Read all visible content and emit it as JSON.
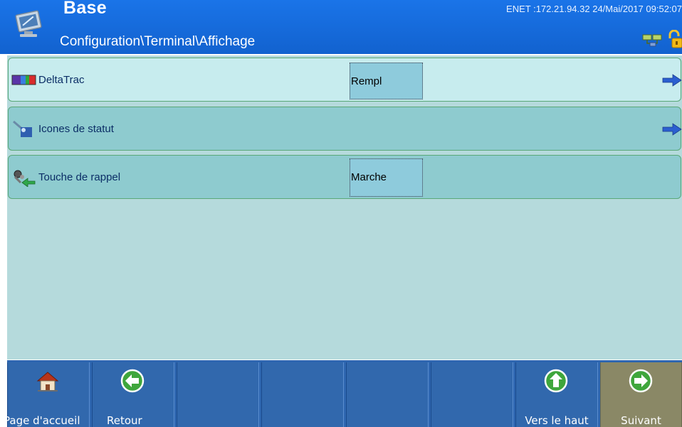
{
  "header": {
    "title": "Base",
    "path": "Configuration\\Terminal\\Affichage",
    "status": "ENET :172.21.94.32 24/Mai/2017 09:52:07",
    "app_icon": "monitor-icon",
    "net_icon": "network-icon",
    "lock_icon": "lock-icon"
  },
  "rows": [
    {
      "label": "DeltaTrac",
      "value": "Rempl",
      "icon": "deltatrac-icon",
      "has_arrow": true
    },
    {
      "label": "Icones de statut",
      "value": "",
      "icon": "status-icons-icon",
      "has_arrow": true
    },
    {
      "label": "Touche de rappel",
      "value": "Marche",
      "icon": "recall-key-icon",
      "has_arrow": false
    }
  ],
  "softkeys": [
    {
      "label": "Page d'accueil",
      "icon": "home-icon"
    },
    {
      "label": "Retour",
      "icon": "back-arrow-icon"
    },
    {
      "label": "",
      "icon": ""
    },
    {
      "label": "",
      "icon": ""
    },
    {
      "label": "",
      "icon": ""
    },
    {
      "label": "",
      "icon": ""
    },
    {
      "label": "Vers le haut",
      "icon": "up-arrow-icon"
    },
    {
      "label": "Suivant",
      "icon": "next-arrow-icon"
    }
  ],
  "colors": {
    "header_blue": "#1a74e8",
    "row_light": "#c7ecee",
    "row_teal": "#8ecbcf",
    "softkey_blue": "#3168ad",
    "softkey_highlight": "#8a8866"
  }
}
